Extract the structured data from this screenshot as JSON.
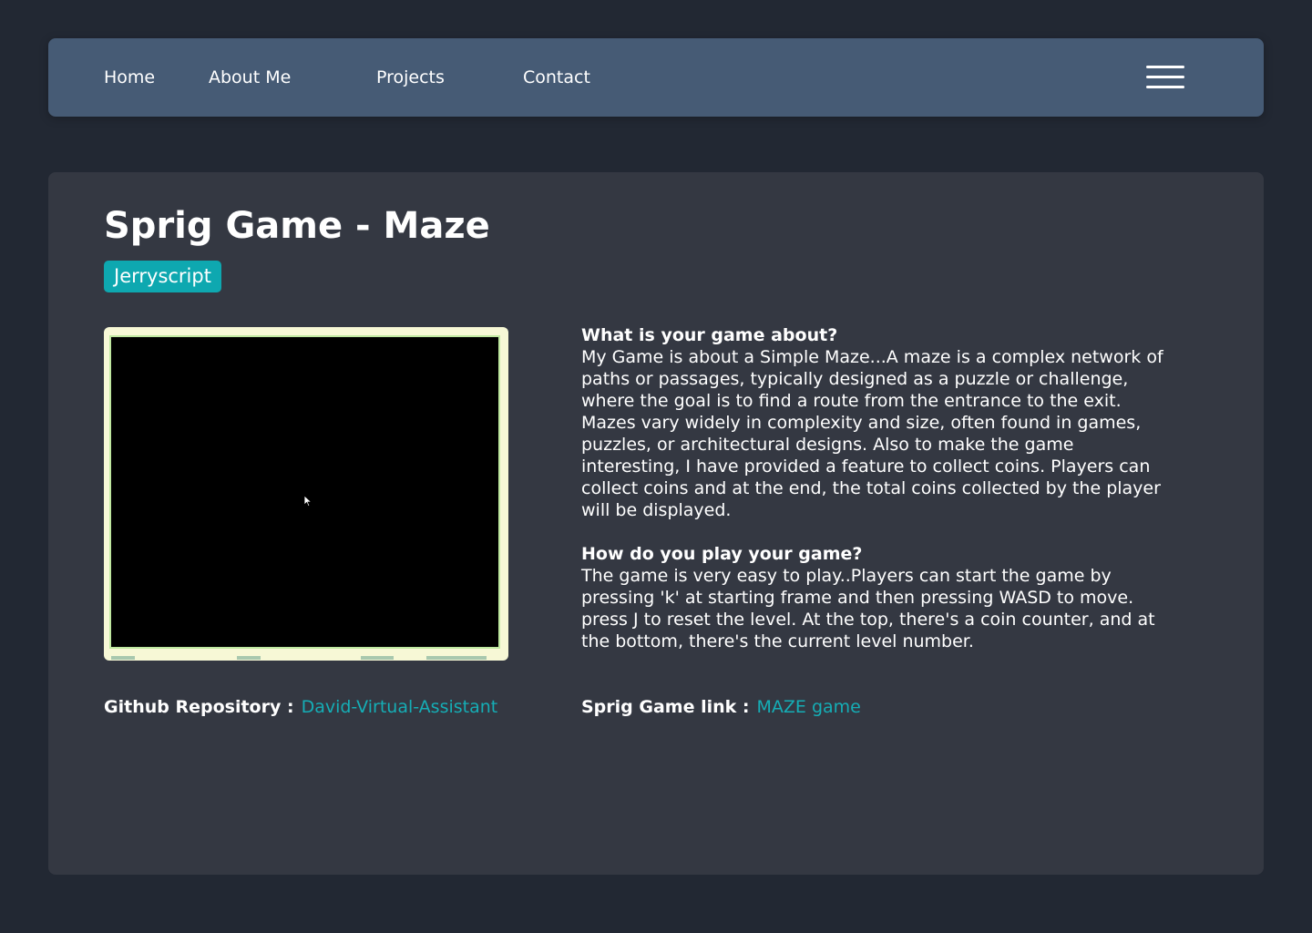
{
  "nav": {
    "links": [
      "Home",
      "About Me",
      "Projects",
      "Contact"
    ],
    "menu_icon": "hamburger-menu-icon"
  },
  "project": {
    "title": "Sprig Game - Maze",
    "tech_badge": "Jerryscript",
    "preview_icon": "mouse-cursor-icon",
    "sections": [
      {
        "question": "What is your game about?",
        "answer": "My Game is about a Simple Maze...A maze is a complex network of paths or passages, typically designed as a puzzle or challenge, where the goal is to find a route from the entrance to the exit. Mazes vary widely in complexity and size, often found in games, puzzles, or architectural designs. Also to make the game interesting, I have provided a feature to collect coins. Players can collect coins and at the end, the total coins collected by the player will be displayed."
      },
      {
        "question": "How do you play your game?",
        "answer": "The game is very easy to play..Players can start the game by pressing 'k' at starting frame and then pressing WASD to move. press J to reset the level. At the top, there's a coin counter, and at the bottom, there's the current level number."
      }
    ],
    "github_label": "Github Repository :",
    "github_link": "David-Virtual-Assistant",
    "sprig_label": "Sprig Game link :",
    "sprig_link": "MAZE game"
  },
  "colors": {
    "page_background": "#222833",
    "navbar": "#465b75",
    "card": "#343842",
    "accent": "#0ea8b0",
    "link": "#15aeb6"
  }
}
